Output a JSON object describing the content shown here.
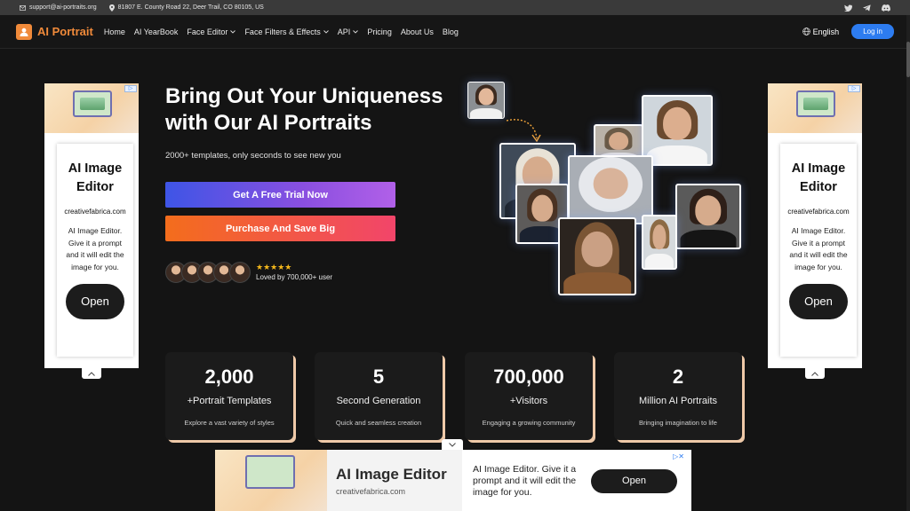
{
  "topbar": {
    "email": "support@ai-portraits.org",
    "address": "81807 E. County Road 22, Deer Trail, CO 80105, US",
    "social": [
      "twitter-icon",
      "telegram-icon",
      "discord-icon"
    ]
  },
  "nav": {
    "brand": "AI Portrait",
    "items": [
      {
        "label": "Home",
        "dropdown": false
      },
      {
        "label": "AI YearBook",
        "dropdown": false
      },
      {
        "label": "Face Editor",
        "dropdown": true
      },
      {
        "label": "Face Filters & Effects",
        "dropdown": true
      },
      {
        "label": "API",
        "dropdown": true
      },
      {
        "label": "Pricing",
        "dropdown": false
      },
      {
        "label": "About Us",
        "dropdown": false
      },
      {
        "label": "Blog",
        "dropdown": false
      }
    ],
    "language": "English",
    "login": "Log in"
  },
  "side_ad": {
    "title": "AI Image Editor",
    "site": "creativefabrica.com",
    "desc": "AI Image Editor. Give it a prompt and it will edit the image for you.",
    "open": "Open"
  },
  "hero": {
    "title": "Bring Out Your Uniqueness with Our AI Portraits",
    "subtitle": "2000+ templates, only seconds to see new you",
    "trial_button": "Get A Free Trial Now",
    "buy_button": "Purchase And Save Big",
    "stars": "★★★★★",
    "loved": "Loved by 700,000+ user"
  },
  "stats": [
    {
      "num": "2,000",
      "label": "+Portrait Templates",
      "desc": "Explore a vast variety of styles"
    },
    {
      "num": "5",
      "label": "Second Generation",
      "desc": "Quick and seamless creation"
    },
    {
      "num": "700,000",
      "label": "+Visitors",
      "desc": "Engaging a growing community"
    },
    {
      "num": "2",
      "label": "Million AI Portraits",
      "desc": "Bringing imagination to life"
    }
  ],
  "bottom_ad": {
    "title": "AI Image Editor",
    "site": "creativefabrica.com",
    "desc": "AI Image Editor. Give it a prompt and it will edit the image for you.",
    "open": "Open"
  },
  "colors": {
    "brand": "#f08a3a",
    "login": "#2d7cf0",
    "stat_shadow": "#efc9a8"
  }
}
